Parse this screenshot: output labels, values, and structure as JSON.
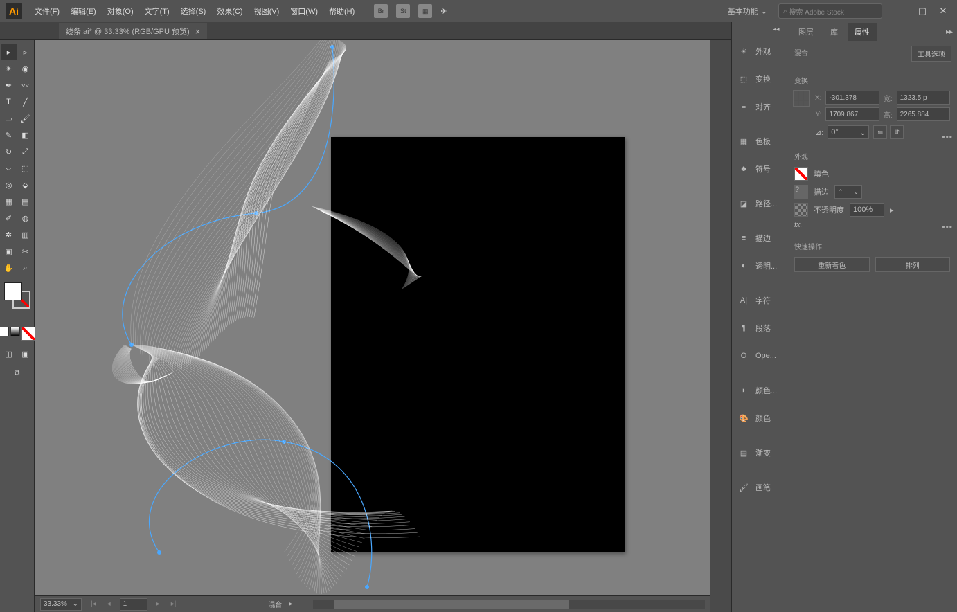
{
  "menubar": {
    "logo": "Ai",
    "items": [
      "文件(F)",
      "编辑(E)",
      "对象(O)",
      "文字(T)",
      "选择(S)",
      "效果(C)",
      "视图(V)",
      "窗口(W)",
      "帮助(H)"
    ],
    "icon_labels": [
      "Br",
      "St"
    ],
    "workspace": "基本功能",
    "search_placeholder": "搜索 Adobe Stock"
  },
  "tab": {
    "title": "线条.ai* @ 33.33% (RGB/GPU 预览)"
  },
  "statusbar": {
    "zoom": "33.33%",
    "artboard": "1",
    "tool": "混合"
  },
  "dock": {
    "items": [
      "外观",
      "变换",
      "对齐",
      "色板",
      "符号",
      "路径...",
      "描边",
      "透明...",
      "字符",
      "段落",
      "Ope...",
      "颜色...",
      "颜色",
      "渐变",
      "画笔"
    ]
  },
  "prop_tabs": {
    "t1": "图层",
    "t2": "库",
    "t3": "属性"
  },
  "prop": {
    "title": "混合",
    "tool_options": "工具选项",
    "transform": "变换",
    "x_lbl": "X:",
    "y_lbl": "Y:",
    "w_lbl": "宽:",
    "h_lbl": "高:",
    "x": "-301.378",
    "y": "1709.867",
    "w": "1323.5 p",
    "h": "2265.884",
    "angle_lbl": "⊿:",
    "angle": "0°",
    "appearance": "外观",
    "fill_lbl": "填色",
    "stroke_lbl": "描边",
    "stroke_val": "",
    "opacity_lbl": "不透明度",
    "opacity": "100%",
    "fx": "fx.",
    "quick": "快速操作",
    "btn_recolor": "重新着色",
    "btn_arrange": "排列"
  }
}
